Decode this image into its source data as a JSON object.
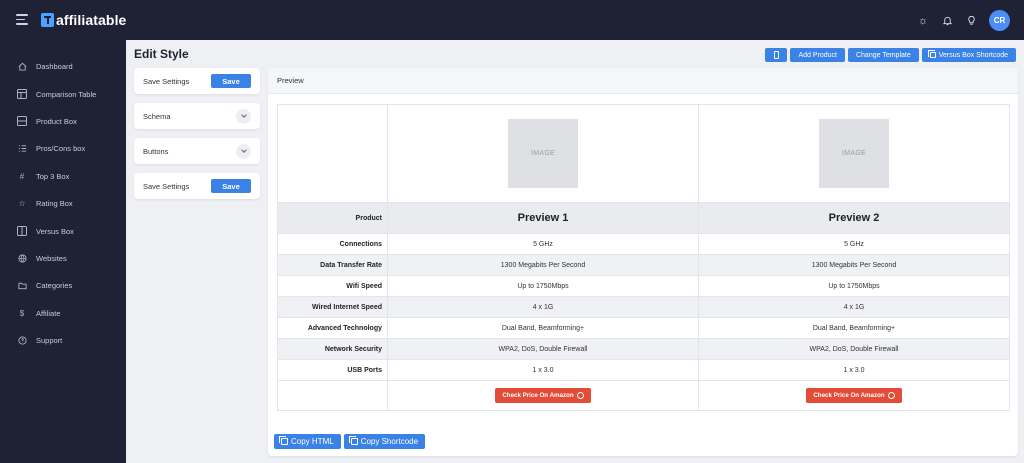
{
  "app": {
    "logo_text": "affiliatable",
    "avatar_initials": "CR"
  },
  "sidebar": {
    "items": [
      {
        "label": "Dashboard",
        "icon": "home-icon"
      },
      {
        "label": "Comparison Table",
        "icon": "table-icon"
      },
      {
        "label": "Product Box",
        "icon": "box-icon"
      },
      {
        "label": "Pros/Cons box",
        "icon": "list-icon"
      },
      {
        "label": "Top 3 Box",
        "icon": "hash-icon"
      },
      {
        "label": "Rating Box",
        "icon": "star-icon"
      },
      {
        "label": "Versus Box",
        "icon": "columns-icon"
      },
      {
        "label": "Websites",
        "icon": "globe-icon"
      },
      {
        "label": "Categories",
        "icon": "folder-icon"
      },
      {
        "label": "Affiliate",
        "icon": "dollar-icon"
      },
      {
        "label": "Support",
        "icon": "help-icon"
      }
    ]
  },
  "header": {
    "title": "Edit Style",
    "add_product": "Add Product",
    "change_template": "Change Template",
    "versus_shortcode": "Versus Box Shortcode"
  },
  "settings": {
    "save_settings_label": "Save Settings",
    "save_label": "Save",
    "schema_label": "Schema",
    "buttons_label": "Buttons"
  },
  "preview": {
    "heading": "Preview",
    "image_placeholder": "IMAGE",
    "product_label": "Product",
    "products": [
      "Preview 1",
      "Preview 2"
    ],
    "rows": [
      {
        "label": "Connections",
        "values": [
          "5 GHz",
          "5 GHz"
        ]
      },
      {
        "label": "Data Transfer Rate",
        "values": [
          "1300 Megabits Per Second",
          "1300 Megabits Per Second"
        ]
      },
      {
        "label": "Wifi Speed",
        "values": [
          "Up to 1750Mbps",
          "Up to 1750Mbps"
        ]
      },
      {
        "label": "Wired Internet Speed",
        "values": [
          "4 x 1G",
          "4 x 1G"
        ]
      },
      {
        "label": "Advanced Technology",
        "values": [
          "Dual Band, Beamforming+",
          "Dual Band, Beamforming+"
        ]
      },
      {
        "label": "Network Security",
        "values": [
          "WPA2, DoS, Double Firewall",
          "WPA2, DoS, Double Firewall"
        ]
      },
      {
        "label": "USB Ports",
        "values": [
          "1 x 3.0",
          "1 x 3.0"
        ]
      }
    ],
    "cta_label": "Check Price On Amazon"
  },
  "footer": {
    "copy_html": "Copy HTML",
    "copy_shortcode": "Copy Shortcode"
  },
  "colors": {
    "sidebar_bg": "#1f2235",
    "accent": "#3b82e6",
    "cta": "#e34c37"
  }
}
